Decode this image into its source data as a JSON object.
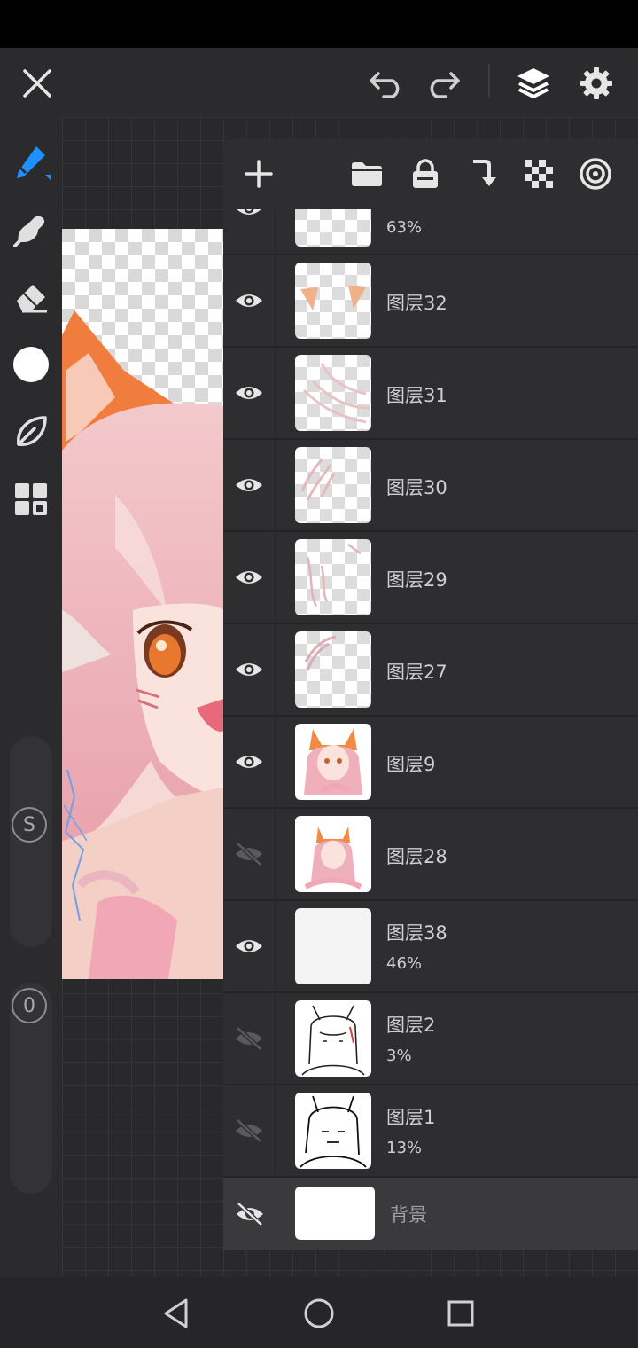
{
  "top_bar": {
    "close_icon": "close-icon",
    "undo_icon": "undo-icon",
    "redo_icon": "redo-icon",
    "layers_icon": "layers-icon",
    "settings_icon": "gear-icon"
  },
  "tools": {
    "brush": "brush-icon",
    "smudge": "smudge-icon",
    "eraser": "eraser-icon",
    "color": "color-swatch",
    "liquify": "leaf-icon",
    "gallery": "grid-icon",
    "size_label": "S",
    "opacity_label": "0",
    "accent_color": "#1e90ff",
    "current_color": "#ffffff"
  },
  "layer_toolbar": {
    "add": "plus-icon",
    "folder": "folder-icon",
    "lock": "lock-icon",
    "merge_down": "merge-down-icon",
    "alpha": "checkerboard-icon",
    "blend": "blend-mode-icon"
  },
  "layers": [
    {
      "name": "",
      "opacity": "63%",
      "visible": true
    },
    {
      "name": "图层32",
      "opacity": "",
      "visible": true
    },
    {
      "name": "图层31",
      "opacity": "",
      "visible": true
    },
    {
      "name": "图层30",
      "opacity": "",
      "visible": true
    },
    {
      "name": "图层29",
      "opacity": "",
      "visible": true
    },
    {
      "name": "图层27",
      "opacity": "",
      "visible": true
    },
    {
      "name": "图层9",
      "opacity": "",
      "visible": true
    },
    {
      "name": "图层28",
      "opacity": "",
      "visible": false
    },
    {
      "name": "图层38",
      "opacity": "46%",
      "visible": true
    },
    {
      "name": "图层2",
      "opacity": "3%",
      "visible": false
    },
    {
      "name": "图层1",
      "opacity": "13%",
      "visible": false
    }
  ],
  "background_layer": {
    "name": "背景",
    "visible": false
  },
  "nav": {
    "back": "back-icon",
    "home": "home-icon",
    "recents": "recents-icon"
  }
}
